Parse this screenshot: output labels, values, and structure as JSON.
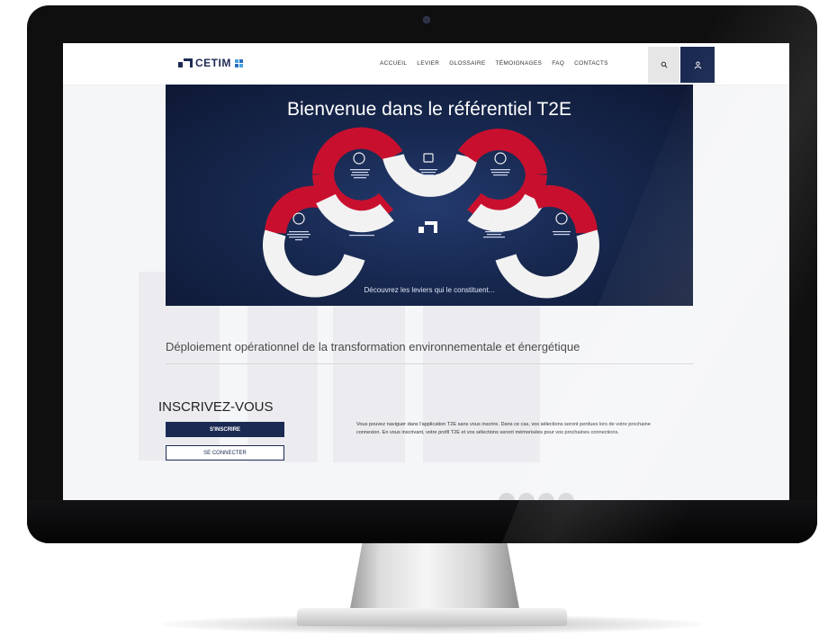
{
  "brand": {
    "name": "CETIM"
  },
  "nav": {
    "items": [
      "ACCUEIL",
      "LEVIER",
      "GLOSSAIRE",
      "TÉMOIGNAGES",
      "FAQ",
      "CONTACTS"
    ]
  },
  "hero": {
    "title": "Bienvenue dans le référentiel T2E",
    "subtitle": "Découvrez les leviers qui le constituent..."
  },
  "section": {
    "title": "Déploiement opérationnel de la transformation environnementale et énergétique"
  },
  "signup": {
    "heading": "INSCRIVEZ-VOUS",
    "signup_button": "S'INSCRIRE",
    "login_button": "SE CONNECTER",
    "info_text": "Vous pouvez naviguer dans l'application T2E sans vous inscrire. Dans ce cas, vos sélections seront perdues lors de votre prochaine connexion. En vous inscrivant, votre profil T2E et vos sélections seront mémorisées pour vos prochaines connections."
  },
  "colors": {
    "navy": "#1b2a52",
    "hero_bg": "#17284f",
    "arc_red": "#c8102e",
    "arc_white": "#f2f2f2"
  },
  "icons": [
    "search-icon",
    "user-icon",
    "levier-icon"
  ]
}
